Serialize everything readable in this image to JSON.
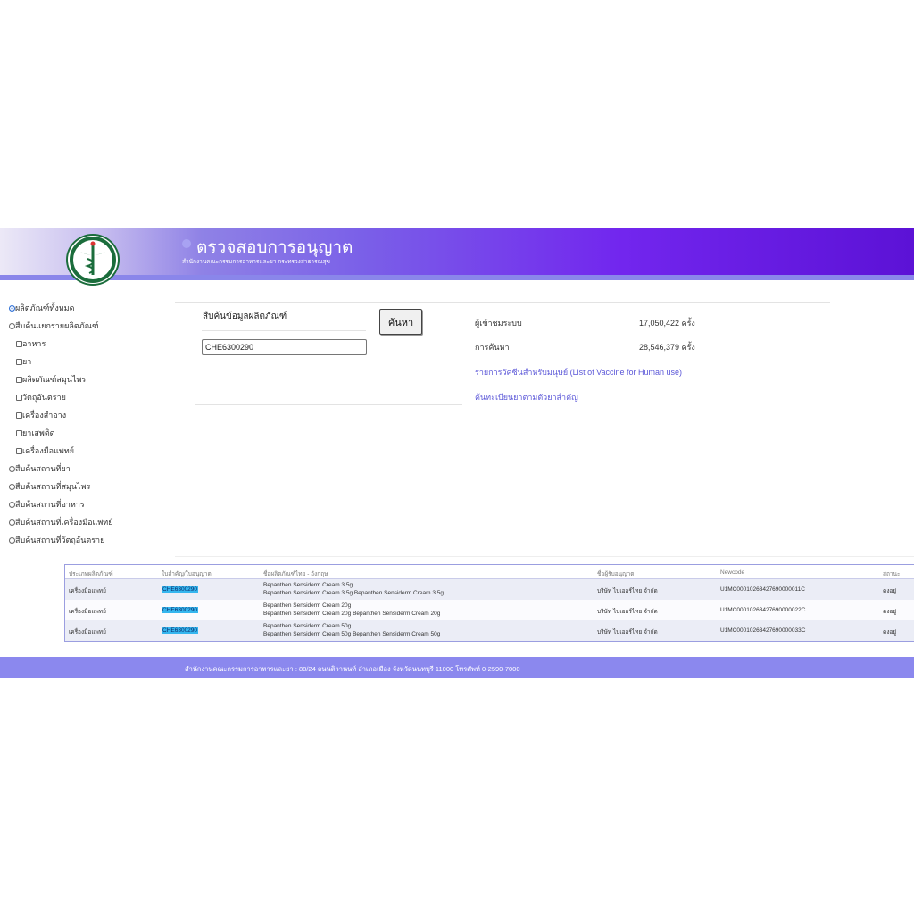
{
  "header": {
    "logo_text": "กระทรวงสาธารณสุข MINISTRY OF PUBLIC HEALTH",
    "title": "ตรวจสอบการอนุญาต",
    "subtitle": "สำนักงานคณะกรรมการอาหารและยา กระทรวงสาธารณสุข"
  },
  "sidebar": {
    "items": [
      {
        "label": "ผลิตภัณฑ์ทั้งหมด",
        "type": "radio",
        "checked": true
      },
      {
        "label": "สืบค้นแยกรายผลิตภัณฑ์",
        "type": "radio",
        "checked": false
      },
      {
        "label": "อาหาร",
        "type": "checkbox",
        "checked": false
      },
      {
        "label": "ยา",
        "type": "checkbox",
        "checked": false
      },
      {
        "label": "ผลิตภัณฑ์สมุนไพร",
        "type": "checkbox",
        "checked": false
      },
      {
        "label": "วัตถุอันตราย",
        "type": "checkbox",
        "checked": false
      },
      {
        "label": "เครื่องสำอาง",
        "type": "checkbox",
        "checked": false
      },
      {
        "label": "ยาเสพติด",
        "type": "checkbox",
        "checked": false
      },
      {
        "label": "เครื่องมือแพทย์",
        "type": "checkbox",
        "checked": false
      },
      {
        "label": "สืบค้นสถานที่ยา",
        "type": "radio",
        "checked": false
      },
      {
        "label": "สืบค้นสถานที่สมุนไพร",
        "type": "radio",
        "checked": false
      },
      {
        "label": "สืบค้นสถานที่อาหาร",
        "type": "radio",
        "checked": false
      },
      {
        "label": "สืบค้นสถานที่เครื่องมือแพทย์",
        "type": "radio",
        "checked": false
      },
      {
        "label": "สืบค้นสถานที่วัตถุอันตราย",
        "type": "radio",
        "checked": false
      }
    ]
  },
  "search": {
    "label": "สืบค้นข้อมูลผลิตภัณฑ์",
    "value": "CHE6300290",
    "button_label": "ค้นหา"
  },
  "stats": {
    "visitors_label": "ผู้เข้าชมระบบ",
    "visitors_value": "17,050,422 ครั้ง",
    "searches_label": "การค้นหา",
    "searches_value": "28,546,379 ครั้ง"
  },
  "links": {
    "vaccine": "รายการวัคซีนสำหรับมนุษย์ (List of Vaccine for Human use)",
    "drug_search": "ค้นทะเบียนยาตามตัวยาสำคัญ"
  },
  "table": {
    "columns": [
      "ประเภทผลิตภัณฑ์",
      "ใบสำคัญ/ใบอนุญาต",
      "ชื่อผลิตภัณฑ์ไทย - อังกฤษ",
      "ชื่อผู้รับอนุญาต",
      "Newcode",
      "สถานะ"
    ],
    "rows": [
      {
        "type": "เครื่องมือแพทย์",
        "license": "CHE6300290",
        "name1": "Bepanthen Sensiderm Cream 3.5g",
        "name2": "Bepanthen Sensiderm Cream 3.5g Bepanthen Sensiderm Cream 3.5g",
        "licensee": "บริษัท ไบเออร์ไทย จำกัด",
        "newcode": "U1MC00010263427690000011C",
        "status": "คงอยู่"
      },
      {
        "type": "เครื่องมือแพทย์",
        "license": "CHE6300290",
        "name1": "Bepanthen Sensiderm Cream 20g",
        "name2": "Bepanthen Sensiderm Cream 20g Bepanthen Sensiderm Cream 20g",
        "licensee": "บริษัท ไบเออร์ไทย จำกัด",
        "newcode": "U1MC00010263427690000022C",
        "status": "คงอยู่"
      },
      {
        "type": "เครื่องมือแพทย์",
        "license": "CHE6300290",
        "name1": "Bepanthen Sensiderm Cream 50g",
        "name2": "Bepanthen Sensiderm Cream 50g Bepanthen Sensiderm Cream 50g",
        "licensee": "บริษัท ไบเออร์ไทย จำกัด",
        "newcode": "U1MC00010263427690000033C",
        "status": "คงอยู่"
      }
    ]
  },
  "footer": {
    "text": "สำนักงานคณะกรรมการอาหารและยา : 88/24 ถนนติวานนท์ อำเภอเมือง จังหวัดนนทบุรี 11000 โทรศัพท์ 0-2590-7000"
  },
  "colors": {
    "banner_accent": "#7226ee",
    "footer_bg": "#8b88ee",
    "link": "#5b57d8",
    "highlight": "#35b6ee"
  }
}
